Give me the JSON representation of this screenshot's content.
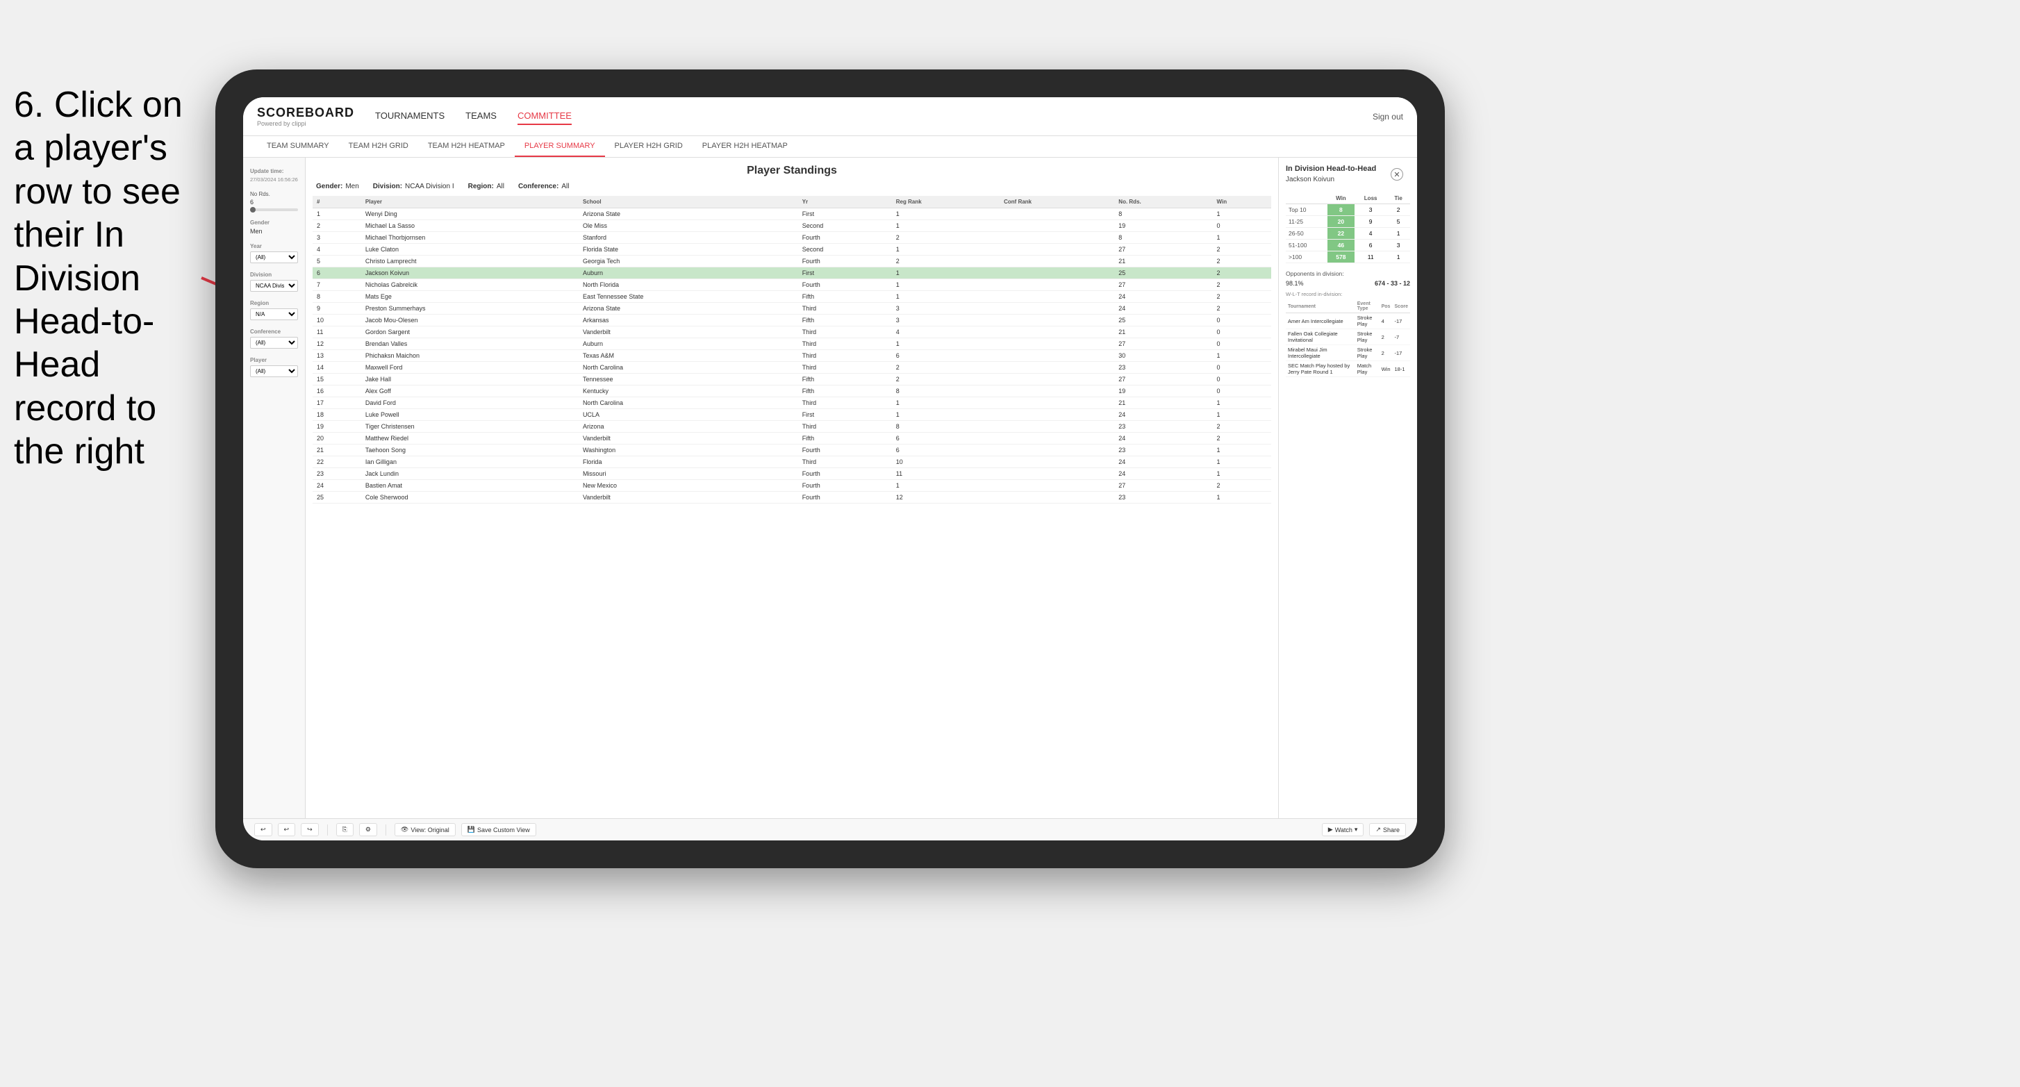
{
  "instruction": {
    "text": "6. Click on a player's row to see their In Division Head-to-Head record to the right"
  },
  "nav": {
    "logo": "SCOREBOARD",
    "powered_by": "Powered by clippi",
    "links": [
      {
        "label": "TOURNAMENTS",
        "active": false
      },
      {
        "label": "TEAMS",
        "active": false
      },
      {
        "label": "COMMITTEE",
        "active": true
      }
    ],
    "sign_out": "Sign out"
  },
  "sub_nav": [
    {
      "label": "TEAM SUMMARY",
      "active": false
    },
    {
      "label": "TEAM H2H GRID",
      "active": false
    },
    {
      "label": "TEAM H2H HEATMAP",
      "active": false
    },
    {
      "label": "PLAYER SUMMARY",
      "active": true
    },
    {
      "label": "PLAYER H2H GRID",
      "active": false
    },
    {
      "label": "PLAYER H2H HEATMAP",
      "active": false
    }
  ],
  "sidebar": {
    "update_label": "Update time:",
    "update_time": "27/03/2024 16:56:26",
    "no_rds_label": "No Rds.",
    "no_rds_value": "6",
    "gender_label": "Gender",
    "gender_value": "Men",
    "year_label": "Year",
    "year_value": "(All)",
    "division_label": "Division",
    "division_value": "NCAA Division I",
    "region_label": "Region",
    "region_value": "N/A",
    "conference_label": "Conference",
    "conference_value": "(All)",
    "player_label": "Player",
    "player_value": "(All)"
  },
  "standings": {
    "title": "Player Standings",
    "gender": "Men",
    "division": "NCAA Division I",
    "region": "All",
    "conference": "All",
    "columns": [
      "#",
      "Player",
      "School",
      "Yr",
      "Reg Rank",
      "Conf Rank",
      "No. Rds.",
      "Win"
    ],
    "rows": [
      {
        "rank": 1,
        "player": "Wenyi Ding",
        "school": "Arizona State",
        "yr": "First",
        "reg_rank": 1,
        "conf_rank": "",
        "no_rds": 8,
        "win": 1
      },
      {
        "rank": 2,
        "player": "Michael La Sasso",
        "school": "Ole Miss",
        "yr": "Second",
        "reg_rank": 1,
        "conf_rank": "",
        "no_rds": 19,
        "win": 0
      },
      {
        "rank": 3,
        "player": "Michael Thorbjornsen",
        "school": "Stanford",
        "yr": "Fourth",
        "reg_rank": 2,
        "conf_rank": "",
        "no_rds": 8,
        "win": 1
      },
      {
        "rank": 4,
        "player": "Luke Claton",
        "school": "Florida State",
        "yr": "Second",
        "reg_rank": 1,
        "conf_rank": "",
        "no_rds": 27,
        "win": 2
      },
      {
        "rank": 5,
        "player": "Christo Lamprecht",
        "school": "Georgia Tech",
        "yr": "Fourth",
        "reg_rank": 2,
        "conf_rank": "",
        "no_rds": 21,
        "win": 2
      },
      {
        "rank": 6,
        "player": "Jackson Koivun",
        "school": "Auburn",
        "yr": "First",
        "reg_rank": 1,
        "conf_rank": "",
        "no_rds": 25,
        "win": 2,
        "selected": true
      },
      {
        "rank": 7,
        "player": "Nicholas Gabrelcik",
        "school": "North Florida",
        "yr": "Fourth",
        "reg_rank": 1,
        "conf_rank": "",
        "no_rds": 27,
        "win": 2
      },
      {
        "rank": 8,
        "player": "Mats Ege",
        "school": "East Tennessee State",
        "yr": "Fifth",
        "reg_rank": 1,
        "conf_rank": "",
        "no_rds": 24,
        "win": 2
      },
      {
        "rank": 9,
        "player": "Preston Summerhays",
        "school": "Arizona State",
        "yr": "Third",
        "reg_rank": 3,
        "conf_rank": "",
        "no_rds": 24,
        "win": 2
      },
      {
        "rank": 10,
        "player": "Jacob Mou-Olesen",
        "school": "Arkansas",
        "yr": "Fifth",
        "reg_rank": 3,
        "conf_rank": "",
        "no_rds": 25,
        "win": 0
      },
      {
        "rank": 11,
        "player": "Gordon Sargent",
        "school": "Vanderbilt",
        "yr": "Third",
        "reg_rank": 4,
        "conf_rank": "",
        "no_rds": 21,
        "win": 0
      },
      {
        "rank": 12,
        "player": "Brendan Valles",
        "school": "Auburn",
        "yr": "Third",
        "reg_rank": 1,
        "conf_rank": "",
        "no_rds": 27,
        "win": 0
      },
      {
        "rank": 13,
        "player": "Phichaksn Maichon",
        "school": "Texas A&M",
        "yr": "Third",
        "reg_rank": 6,
        "conf_rank": "",
        "no_rds": 30,
        "win": 1
      },
      {
        "rank": 14,
        "player": "Maxwell Ford",
        "school": "North Carolina",
        "yr": "Third",
        "reg_rank": 2,
        "conf_rank": "",
        "no_rds": 23,
        "win": 0
      },
      {
        "rank": 15,
        "player": "Jake Hall",
        "school": "Tennessee",
        "yr": "Fifth",
        "reg_rank": 2,
        "conf_rank": "",
        "no_rds": 27,
        "win": 0
      },
      {
        "rank": 16,
        "player": "Alex Goff",
        "school": "Kentucky",
        "yr": "Fifth",
        "reg_rank": 8,
        "conf_rank": "",
        "no_rds": 19,
        "win": 0
      },
      {
        "rank": 17,
        "player": "David Ford",
        "school": "North Carolina",
        "yr": "Third",
        "reg_rank": 1,
        "conf_rank": "",
        "no_rds": 21,
        "win": 1
      },
      {
        "rank": 18,
        "player": "Luke Powell",
        "school": "UCLA",
        "yr": "First",
        "reg_rank": 1,
        "conf_rank": "",
        "no_rds": 24,
        "win": 1
      },
      {
        "rank": 19,
        "player": "Tiger Christensen",
        "school": "Arizona",
        "yr": "Third",
        "reg_rank": 8,
        "conf_rank": "",
        "no_rds": 23,
        "win": 2
      },
      {
        "rank": 20,
        "player": "Matthew Riedel",
        "school": "Vanderbilt",
        "yr": "Fifth",
        "reg_rank": 6,
        "conf_rank": "",
        "no_rds": 24,
        "win": 2
      },
      {
        "rank": 21,
        "player": "Taehoon Song",
        "school": "Washington",
        "yr": "Fourth",
        "reg_rank": 6,
        "conf_rank": "",
        "no_rds": 23,
        "win": 1
      },
      {
        "rank": 22,
        "player": "Ian Gilligan",
        "school": "Florida",
        "yr": "Third",
        "reg_rank": 10,
        "conf_rank": "",
        "no_rds": 24,
        "win": 1
      },
      {
        "rank": 23,
        "player": "Jack Lundin",
        "school": "Missouri",
        "yr": "Fourth",
        "reg_rank": 11,
        "conf_rank": "",
        "no_rds": 24,
        "win": 1
      },
      {
        "rank": 24,
        "player": "Bastien Amat",
        "school": "New Mexico",
        "yr": "Fourth",
        "reg_rank": 1,
        "conf_rank": "",
        "no_rds": 27,
        "win": 2
      },
      {
        "rank": 25,
        "player": "Cole Sherwood",
        "school": "Vanderbilt",
        "yr": "Fourth",
        "reg_rank": 12,
        "conf_rank": "",
        "no_rds": 23,
        "win": 1
      }
    ]
  },
  "h2h": {
    "title": "In Division Head-to-Head",
    "player": "Jackson Koivun",
    "table_headers": [
      "",
      "Win",
      "Loss",
      "Tie"
    ],
    "rows": [
      {
        "label": "Top 10",
        "win": 8,
        "loss": 3,
        "tie": 2
      },
      {
        "label": "11-25",
        "win": 20,
        "loss": 9,
        "tie": 5
      },
      {
        "label": "26-50",
        "win": 22,
        "loss": 4,
        "tie": 1
      },
      {
        "label": "51-100",
        "win": 46,
        "loss": 6,
        "tie": 3
      },
      {
        "label": ">100",
        "win": 578,
        "loss": 11,
        "tie": 1
      }
    ],
    "opponents_label": "Opponents in division:",
    "wlt_label": "W-L-T record in-division:",
    "pct": "98.1%",
    "record": "674 - 33 - 12",
    "tournament_headers": [
      "Tournament",
      "Event Type",
      "Pos",
      "Score"
    ],
    "tournaments": [
      {
        "name": "Amer Am Intercollegiate",
        "type": "Stroke Play",
        "pos": 4,
        "score": "-17"
      },
      {
        "name": "Fallen Oak Collegiate Invitational",
        "type": "Stroke Play",
        "pos": 2,
        "score": "-7"
      },
      {
        "name": "Mirabel Maui Jim Intercollegiate",
        "type": "Stroke Play",
        "pos": 2,
        "score": "-17"
      },
      {
        "name": "SEC Match Play hosted by Jerry Pate Round 1",
        "type": "Match Play",
        "pos": "Win",
        "score": "18-1"
      }
    ]
  },
  "toolbar": {
    "view_original": "View: Original",
    "save_custom": "Save Custom View",
    "watch": "Watch",
    "share": "Share"
  }
}
